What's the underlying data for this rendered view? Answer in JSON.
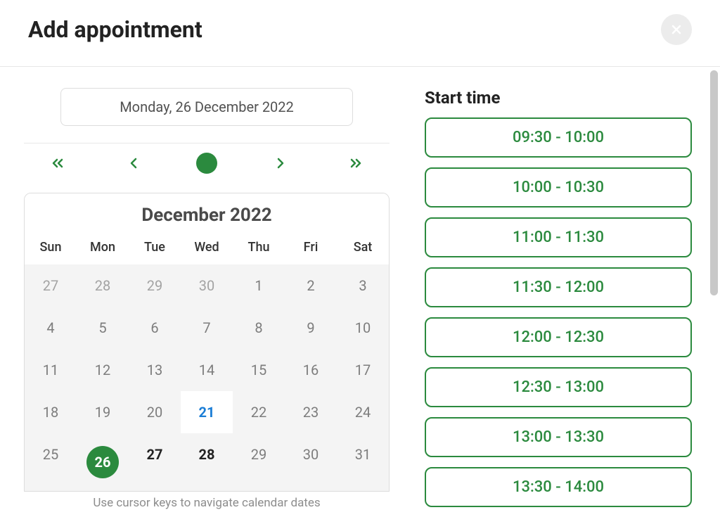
{
  "header": {
    "title": "Add appointment"
  },
  "selected_date_display": "Monday, 26 December 2022",
  "calendar": {
    "month_label": "December 2022",
    "dow": [
      "Sun",
      "Mon",
      "Tue",
      "Wed",
      "Thu",
      "Fri",
      "Sat"
    ],
    "weeks": [
      [
        {
          "n": "27",
          "cls": "out"
        },
        {
          "n": "28",
          "cls": "out"
        },
        {
          "n": "29",
          "cls": "out"
        },
        {
          "n": "30",
          "cls": "out"
        },
        {
          "n": "1",
          "cls": ""
        },
        {
          "n": "2",
          "cls": ""
        },
        {
          "n": "3",
          "cls": ""
        }
      ],
      [
        {
          "n": "4",
          "cls": ""
        },
        {
          "n": "5",
          "cls": ""
        },
        {
          "n": "6",
          "cls": ""
        },
        {
          "n": "7",
          "cls": ""
        },
        {
          "n": "8",
          "cls": ""
        },
        {
          "n": "9",
          "cls": ""
        },
        {
          "n": "10",
          "cls": ""
        }
      ],
      [
        {
          "n": "11",
          "cls": ""
        },
        {
          "n": "12",
          "cls": ""
        },
        {
          "n": "13",
          "cls": ""
        },
        {
          "n": "14",
          "cls": ""
        },
        {
          "n": "15",
          "cls": ""
        },
        {
          "n": "16",
          "cls": ""
        },
        {
          "n": "17",
          "cls": ""
        }
      ],
      [
        {
          "n": "18",
          "cls": ""
        },
        {
          "n": "19",
          "cls": ""
        },
        {
          "n": "20",
          "cls": ""
        },
        {
          "n": "21",
          "cls": "highlight"
        },
        {
          "n": "22",
          "cls": ""
        },
        {
          "n": "23",
          "cls": ""
        },
        {
          "n": "24",
          "cls": ""
        }
      ],
      [
        {
          "n": "25",
          "cls": ""
        },
        {
          "n": "26",
          "cls": "selected"
        },
        {
          "n": "27",
          "cls": "bold"
        },
        {
          "n": "28",
          "cls": "bold"
        },
        {
          "n": "29",
          "cls": ""
        },
        {
          "n": "30",
          "cls": ""
        },
        {
          "n": "31",
          "cls": ""
        }
      ]
    ],
    "hint": "Use cursor keys to navigate calendar dates"
  },
  "start_time": {
    "title": "Start time",
    "slots": [
      "09:30 - 10:00",
      "10:00 - 10:30",
      "11:00 - 11:30",
      "11:30 - 12:00",
      "12:00 - 12:30",
      "12:30 - 13:00",
      "13:00 - 13:30",
      "13:30 - 14:00"
    ]
  }
}
